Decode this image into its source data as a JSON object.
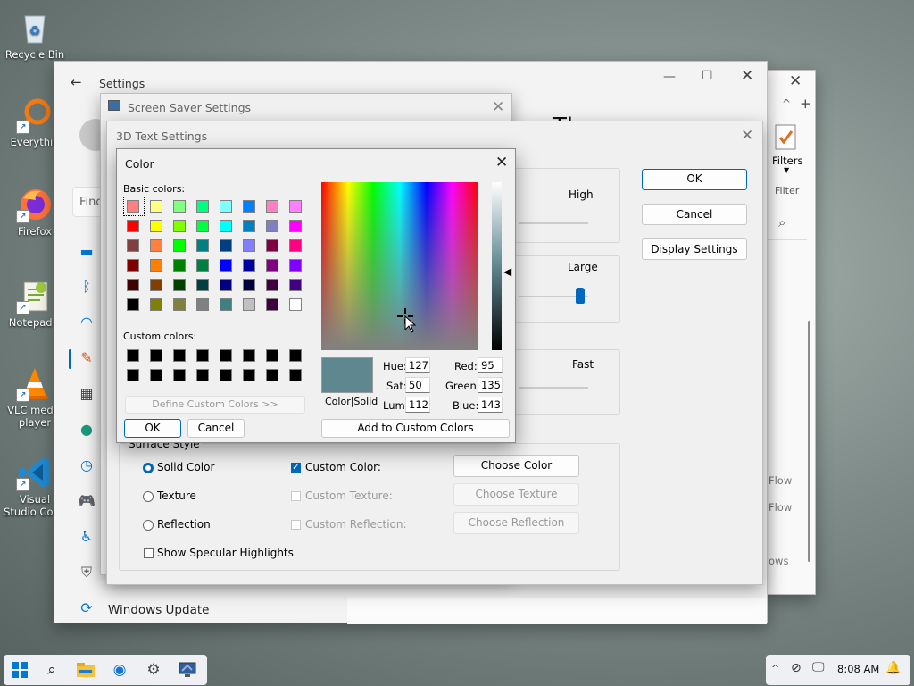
{
  "desktop": {
    "icons": [
      {
        "label": "Recycle Bin"
      },
      {
        "label": "Everythin"
      },
      {
        "label": "Firefox"
      },
      {
        "label": "Notepad+"
      },
      {
        "label": "VLC media player"
      },
      {
        "label": "Visual Studio Code"
      }
    ]
  },
  "settings": {
    "title": "Settings",
    "find_placeholder": "Find",
    "windows_update": "Windows Update",
    "heading_fragment": "Th"
  },
  "rightpane": {
    "filters": "Filters",
    "filter": "Filter",
    "flow1": "Flow",
    "flow2": "Flow",
    "ows": "ows"
  },
  "screensaver": {
    "title": "Screen Saver Settings"
  },
  "text3d": {
    "title": "3D Text Settings",
    "ok": "OK",
    "cancel": "Cancel",
    "display_settings": "Display Settings",
    "slider_high": "High",
    "slider_large": "Large",
    "slider_fast": "Fast",
    "surface_style": "Surface Style",
    "solid_color": "Solid Color",
    "texture": "Texture",
    "reflection": "Reflection",
    "show_specular": "Show Specular Highlights",
    "custom_color": "Custom Color:",
    "custom_texture": "Custom Texture:",
    "custom_reflection": "Custom Reflection:",
    "choose_color": "Choose Color",
    "choose_texture": "Choose Texture",
    "choose_reflection": "Choose Reflection"
  },
  "color_dialog": {
    "title": "Color",
    "basic_colors_label": "Basic colors:",
    "custom_colors_label": "Custom colors:",
    "define_custom": "Define Custom Colors >>",
    "ok": "OK",
    "cancel": "Cancel",
    "color_solid": "Color|Solid",
    "add_to_custom": "Add to Custom Colors",
    "hue_label": "Hue:",
    "hue": "127",
    "sat_label": "Sat:",
    "sat": "50",
    "lum_label": "Lum:",
    "lum": "112",
    "red_label": "Red:",
    "red": "95",
    "green_label": "Green:",
    "green": "135",
    "blue_label": "Blue:",
    "blue": "143",
    "preview_color": "#5f878f",
    "basic_colors": [
      "#ff8080",
      "#ffff80",
      "#80ff80",
      "#00ff80",
      "#80ffff",
      "#0080ff",
      "#ff80c0",
      "#ff80ff",
      "#ff0000",
      "#ffff00",
      "#80ff00",
      "#00ff40",
      "#00ffff",
      "#0080c0",
      "#8080c0",
      "#ff00ff",
      "#804040",
      "#ff8040",
      "#00ff00",
      "#008080",
      "#004080",
      "#8080ff",
      "#800040",
      "#ff0080",
      "#800000",
      "#ff8000",
      "#008000",
      "#008040",
      "#0000ff",
      "#0000a0",
      "#800080",
      "#8000ff",
      "#400000",
      "#804000",
      "#004000",
      "#004040",
      "#000080",
      "#000040",
      "#400040",
      "#400080",
      "#000000",
      "#808000",
      "#808040",
      "#808080",
      "#408080",
      "#c0c0c0",
      "#400040",
      "#ffffff"
    ],
    "custom_colors": [
      "#000000",
      "#000000",
      "#000000",
      "#000000",
      "#000000",
      "#000000",
      "#000000",
      "#000000",
      "#000000",
      "#000000",
      "#000000",
      "#000000",
      "#000000",
      "#000000",
      "#000000",
      "#000000"
    ]
  },
  "taskbar": {
    "time": "8:08 AM"
  }
}
